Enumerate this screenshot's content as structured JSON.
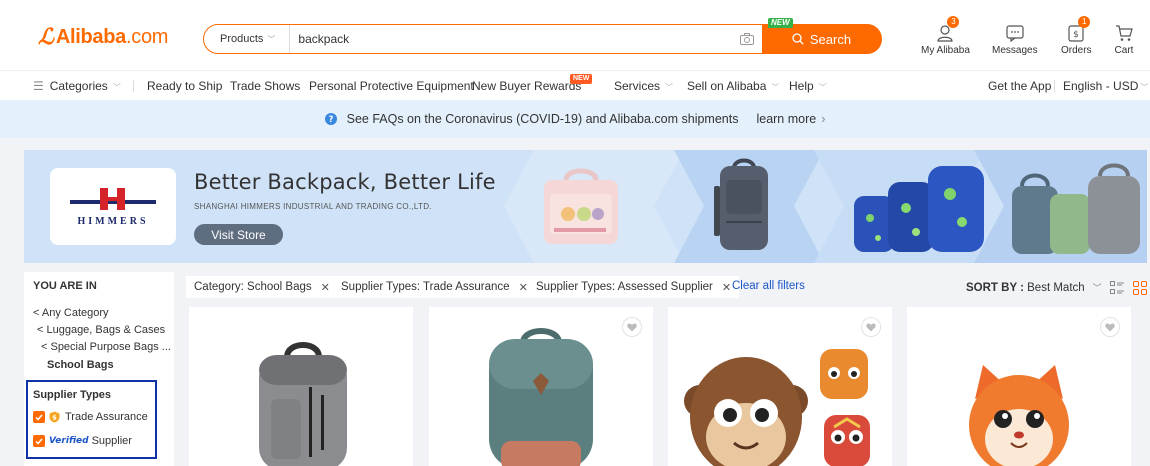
{
  "header": {
    "logo_text": "Alibaba",
    "logo_domain": ".com",
    "search_scope": "Products",
    "search_value": "backpack",
    "search_button": "Search",
    "new_badge": "NEW",
    "actions": [
      {
        "label": "My Alibaba",
        "icon": "user-icon",
        "badge": "3"
      },
      {
        "label": "Messages",
        "icon": "message-icon",
        "badge": ""
      },
      {
        "label": "Orders",
        "icon": "orders-icon",
        "badge": "1"
      },
      {
        "label": "Cart",
        "icon": "cart-icon",
        "badge": ""
      }
    ]
  },
  "nav": {
    "categories": "Categories",
    "ready_to_ship": "Ready to Ship",
    "trade_shows": "Trade Shows",
    "ppe": "Personal Protective Equipment",
    "new_buyer_rewards": "New Buyer Rewards",
    "new_tag": "NEW",
    "services": "Services",
    "sell_on_alibaba": "Sell on Alibaba",
    "help": "Help",
    "get_the_app": "Get the App",
    "language_currency": "English - USD"
  },
  "notice": {
    "text": "See FAQs on the Coronavirus (COVID-19) and Alibaba.com shipments",
    "link": "learn more"
  },
  "banner": {
    "brand": "HIMMERS",
    "title": "Better Backpack, Better Life",
    "subtitle": "SHANGHAI HIMMERS INDUSTRIAL AND TRADING CO.,LTD.",
    "cta": "Visit Store"
  },
  "sidebar": {
    "heading": "YOU ARE IN",
    "crumbs": [
      "< Any Category",
      "< Luggage, Bags & Cases",
      "< Special Purpose Bags ...",
      "School Bags"
    ],
    "supplier_types_title": "Supplier Types",
    "options": [
      {
        "label": "Trade Assurance",
        "checked": true
      },
      {
        "label": "Supplier",
        "prefix": "Verified",
        "checked": true
      }
    ]
  },
  "filters": {
    "chips": [
      "Category: School Bags",
      "Supplier Types: Trade Assurance",
      "Supplier Types: Assessed Supplier"
    ],
    "clear_all": "Clear all filters",
    "sort_label": "SORT BY :",
    "sort_value": "Best Match"
  },
  "colors": {
    "brand_orange": "#ff6a00",
    "link_blue": "#1a55c8",
    "highlight_box": "#1033a8"
  }
}
